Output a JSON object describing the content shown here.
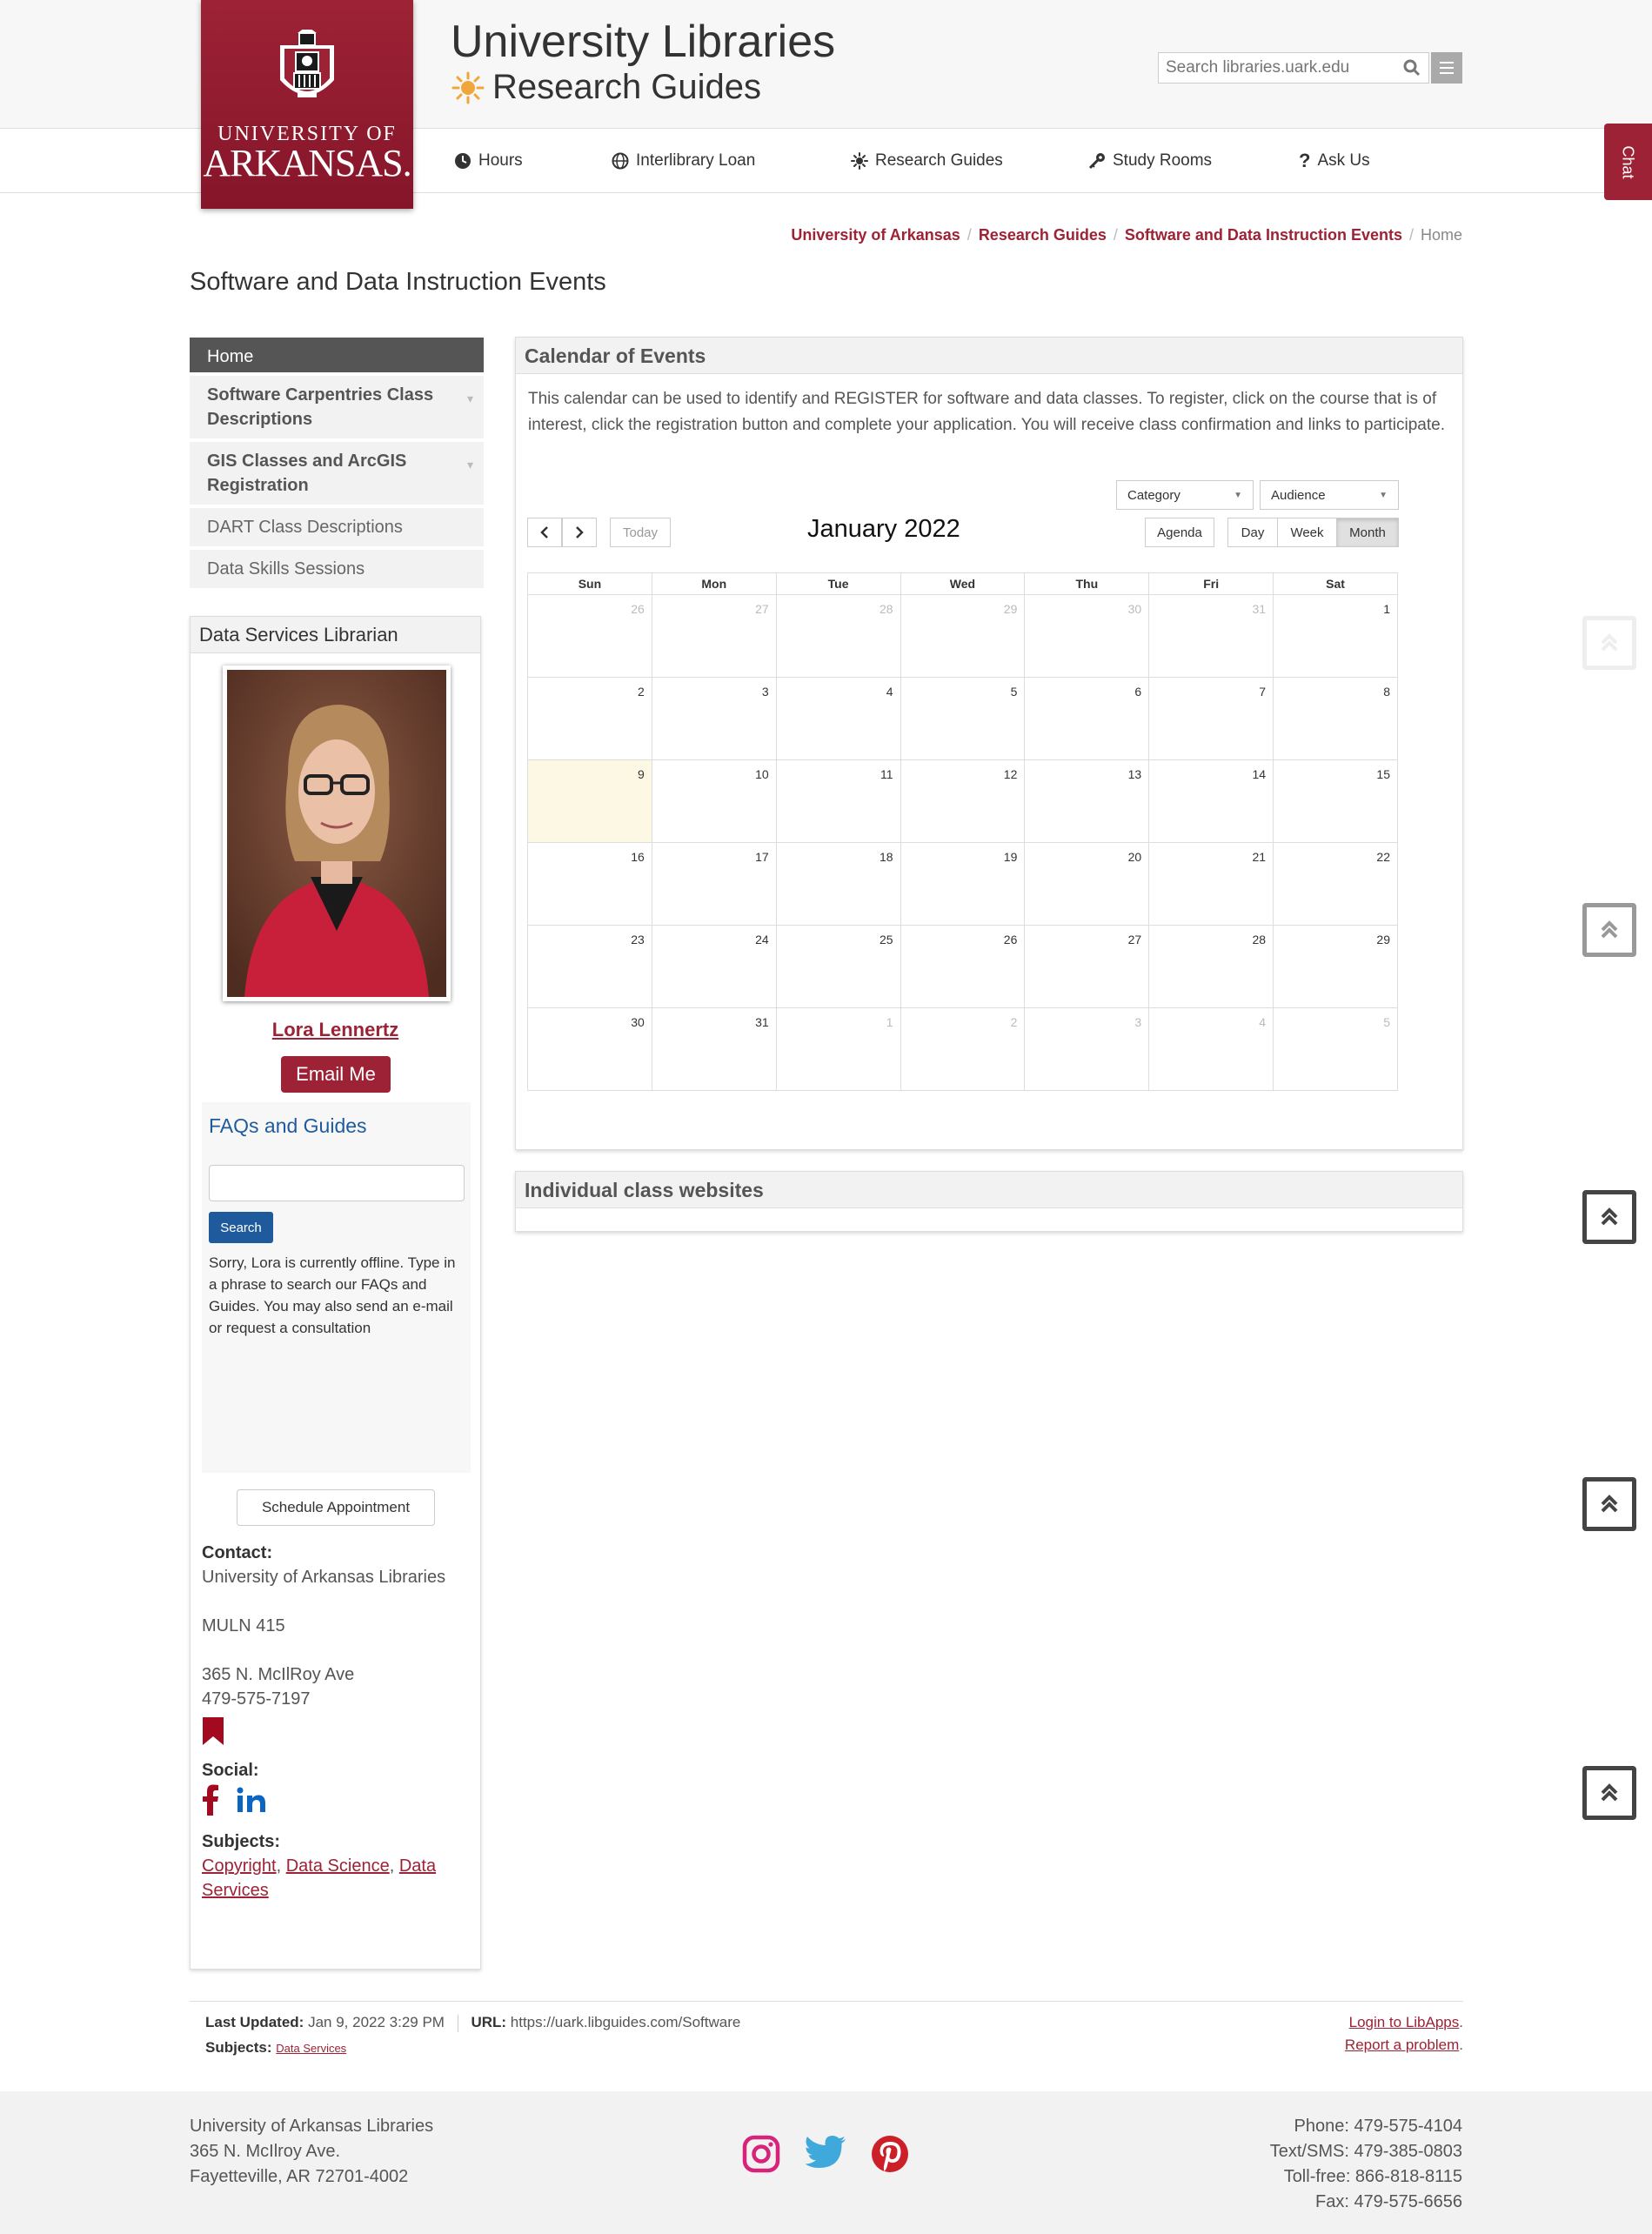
{
  "header": {
    "site_title": "University Libraries",
    "site_subtitle": "Research Guides",
    "logo_line1": "UNIVERSITY OF",
    "logo_line2": "ARKANSAS.",
    "search_placeholder": "Search libraries.uark.edu"
  },
  "nav": [
    {
      "label": "Hours",
      "icon": "clock-icon"
    },
    {
      "label": "Interlibrary Loan",
      "icon": "globe-icon"
    },
    {
      "label": "Research Guides",
      "icon": "sun-icon"
    },
    {
      "label": "Study Rooms",
      "icon": "key-icon"
    },
    {
      "label": "Ask Us",
      "icon": "question-icon"
    }
  ],
  "chat_label": "Chat",
  "breadcrumb": {
    "items": [
      "University of Arkansas",
      "Research Guides",
      "Software and Data Instruction Events"
    ],
    "current": "Home"
  },
  "page_title": "Software and Data Instruction Events",
  "side_nav": [
    {
      "label": "Home"
    },
    {
      "label": "Software Carpentries Class Descriptions"
    },
    {
      "label": "GIS Classes and ArcGIS Registration"
    },
    {
      "label": "DART Class Descriptions"
    },
    {
      "label": "Data Skills Sessions"
    }
  ],
  "librarian": {
    "box_title": "Data Services Librarian",
    "name": "Lora Lennertz",
    "email_button": "Email Me",
    "faq_title": "FAQs and Guides",
    "faq_search_button": "Search",
    "offline_text": "Sorry, Lora is currently offline. Type in a phrase to search our FAQs and Guides. You may also send an e-mail or request a consultation",
    "schedule_button": "Schedule Appointment",
    "contact_label": "Contact:",
    "contact_org": "University of Arkansas Libraries",
    "contact_room": "MULN 415",
    "contact_street": "365 N. McIlRoy Ave",
    "contact_phone": "479-575-7197",
    "social_label": "Social:",
    "subjects_label": "Subjects:",
    "subjects": [
      "Copyright",
      "Data Science",
      "Data Services"
    ]
  },
  "calendar": {
    "panel_title": "Calendar of Events",
    "intro": "This calendar can be used to identify and REGISTER for software and data classes.  To register, click on the course that is of interest, click the registration button and complete your application.  You will receive class confirmation and links to participate.",
    "category_label": "Category",
    "audience_label": "Audience",
    "today_label": "Today",
    "month_title": "January 2022",
    "views": [
      "Agenda",
      "Day",
      "Week",
      "Month"
    ],
    "active_view": "Month",
    "weekdays": [
      "Sun",
      "Mon",
      "Tue",
      "Wed",
      "Thu",
      "Fri",
      "Sat"
    ],
    "weeks": [
      [
        "26",
        "27",
        "28",
        "29",
        "30",
        "31",
        "1"
      ],
      [
        "2",
        "3",
        "4",
        "5",
        "6",
        "7",
        "8"
      ],
      [
        "9",
        "10",
        "11",
        "12",
        "13",
        "14",
        "15"
      ],
      [
        "16",
        "17",
        "18",
        "19",
        "20",
        "21",
        "22"
      ],
      [
        "23",
        "24",
        "25",
        "26",
        "27",
        "28",
        "29"
      ],
      [
        "30",
        "31",
        "1",
        "2",
        "3",
        "4",
        "5"
      ]
    ],
    "today_date": "9"
  },
  "class_panel_title": "Individual class websites",
  "meta": {
    "last_updated_label": "Last Updated:",
    "last_updated": "Jan 9, 2022 3:29 PM",
    "url_label": "URL:",
    "url": "https://uark.libguides.com/Software",
    "subjects_label": "Subjects:",
    "subject": "Data Services",
    "login": "Login to LibApps",
    "report": "Report a problem"
  },
  "footer": {
    "addr1": "University of Arkansas Libraries",
    "addr2": "365 N. McIlroy Ave.",
    "addr3": "Fayetteville, AR 72701-4002",
    "phone": "Phone: 479-575-4104",
    "sms": "Text/SMS: 479-385-0803",
    "tollfree": "Toll-free: 866-818-8115",
    "fax": "Fax: 479-575-6656"
  },
  "colors": {
    "brand": "#9d2235",
    "link_blue": "#1f5b9c",
    "today_bg": "#fdf8e3"
  }
}
